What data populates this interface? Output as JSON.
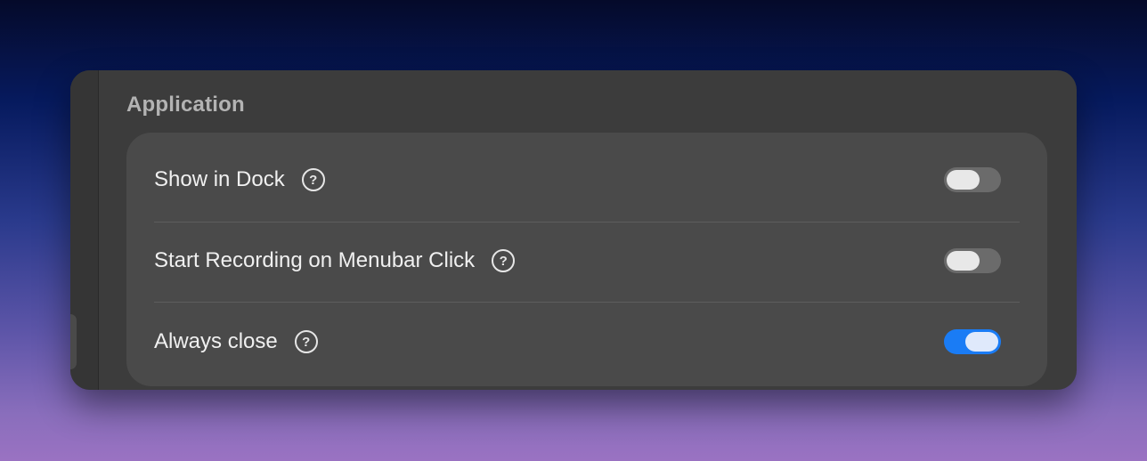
{
  "section": {
    "title": "Application"
  },
  "settings": [
    {
      "label": "Show in Dock",
      "help": "?",
      "enabled": false
    },
    {
      "label": "Start Recording on Menubar Click",
      "help": "?",
      "enabled": false
    },
    {
      "label": "Always close",
      "help": "?",
      "enabled": true
    }
  ],
  "colors": {
    "toggle_on": "#1a7cf5",
    "toggle_off": "#6b6b6b"
  }
}
